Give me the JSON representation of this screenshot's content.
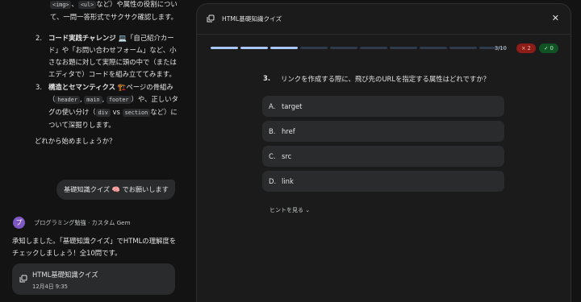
{
  "chat": {
    "intro_line1_after": "など）や属性の役割につい",
    "intro_code1": "<img>",
    "intro_code2": "<ul>",
    "intro_line2": "て、一問一答形式でサクサク確認します。",
    "items": [
      {
        "num": "2.",
        "title": "コード実践チャレンジ 💻",
        "text": "「自己紹介カード」や「お問い合わせフォーム」など、小さなお題に対して実際に頭の中で（またはエディタで）コードを組み立ててみます。"
      },
      {
        "num": "3.",
        "title": "構造とセマンティクス 🏗️",
        "text": "ページの骨組み（",
        "codes": [
          "header",
          "main",
          "footer",
          "div",
          "section"
        ],
        "mid": "）や、正しいタグの使い分け（",
        "vs": " vs ",
        "end": "など）について深掘りします。"
      }
    ],
    "ask": "どれから始めましょうか？",
    "user_message": "基礎知識クイズ 🧠 でお願いします",
    "gem_avatar": "プ",
    "gem_name": "プログラミング勉強 · カスタム Gem",
    "reply": "承知しました。「基礎知識クイズ」でHTMLの理解度をチェックしましょう！全10問です。",
    "card_title": "HTML基礎知識クイズ",
    "card_date": "12月4日 9:35"
  },
  "quiz": {
    "title": "HTML基礎知識クイズ",
    "progress": {
      "current": 3,
      "total": 10,
      "label": "3/10"
    },
    "wrong_count": "2",
    "right_count": "0",
    "wrong_icon": "×",
    "right_icon": "✓",
    "question_num": "3.",
    "question": "リンクを作成する際に、飛び先のURLを指定する属性はどれですか？",
    "options": [
      {
        "letter": "A.",
        "text": "target"
      },
      {
        "letter": "B.",
        "text": "href"
      },
      {
        "letter": "C.",
        "text": "src"
      },
      {
        "letter": "D.",
        "text": "link"
      }
    ],
    "hint_label": "ヒントを見る"
  },
  "colors": {
    "accent": "#a8c7fa",
    "wrong": "#8c1d18",
    "right": "#0f5223",
    "purple": "#7e57c2"
  }
}
